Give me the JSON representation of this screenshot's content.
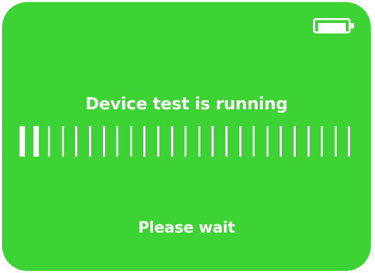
{
  "screen": {
    "background_color": "#3ed334",
    "foreground_color": "#ffffff",
    "title": "Device test is running",
    "subtitle": "Please wait"
  },
  "battery": {
    "icon": "battery-icon",
    "level": 1.0
  },
  "progress": {
    "icon": "segmented-progress-bar",
    "total_segments": 25,
    "completed_segments": 2
  }
}
